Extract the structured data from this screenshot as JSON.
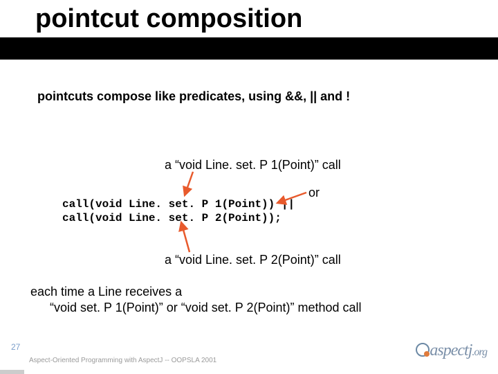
{
  "title": "pointcut composition",
  "intro": "pointcuts compose like predicates, using &&, || and !",
  "annot1": "a “void Line. set. P 1(Point)” call",
  "annot_or": "or",
  "code_line1_pre": "call(",
  "code_line1_kw": "void",
  "code_line1_post": " Line. set. P 1(Point)) ||",
  "code_line2_pre": "call(",
  "code_line2_kw": "void",
  "code_line2_post": " Line. set. P 2(Point));",
  "annot2": "a “void Line. set. P 2(Point)” call",
  "desc_line1": "each time a Line receives a",
  "desc_line2": "“void set. P 1(Point)” or “void set. P 2(Point)” method call",
  "slidenum": "27",
  "footer": "Aspect-Oriented Programming with AspectJ -- OOPSLA 2001",
  "logo": "aspectj",
  "logo_suffix": ".org"
}
